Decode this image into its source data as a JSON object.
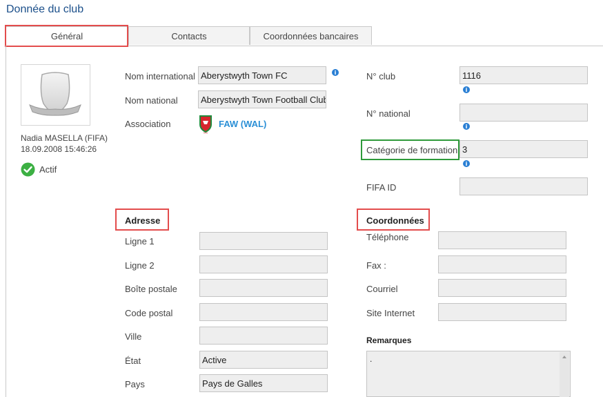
{
  "page": {
    "title": "Donnée du club"
  },
  "tabs": [
    {
      "label": "Général",
      "active": true
    },
    {
      "label": "Contacts",
      "active": false
    },
    {
      "label": "Coordonnées bancaires",
      "active": false
    }
  ],
  "club_card": {
    "logo_icon": "club-shield-placeholder-icon",
    "modified_by": "Nadia MASELLA (FIFA)",
    "modified_at": "18.09.2008 15:46:26",
    "status": "Actif",
    "status_icon": "check-circle-icon",
    "status_color": "#3cb043"
  },
  "identity": {
    "international_name_label": "Nom international",
    "international_name_value": "Aberystwyth Town FC",
    "national_name_label": "Nom national",
    "national_name_value": "Aberystwyth Town Football Club",
    "association_label": "Association",
    "association_value": "FAW (WAL)",
    "association_icon": "faw-crest-icon"
  },
  "club_ids": {
    "club_no_label": "N° club",
    "club_no_value": "1116",
    "national_no_label": "N° national",
    "national_no_value": "",
    "training_category_label": "Catégorie de formation",
    "training_category_value": "3",
    "fifa_id_label": "FIFA ID",
    "fifa_id_value": ""
  },
  "address": {
    "section_title": "Adresse",
    "line1_label": "Ligne 1",
    "line1_value": "",
    "line2_label": "Ligne 2",
    "line2_value": "",
    "po_box_label": "Boîte postale",
    "po_box_value": "",
    "postal_code_label": "Code postal",
    "postal_code_value": "",
    "city_label": "Ville",
    "city_value": "",
    "state_label": "État",
    "state_value": "Active",
    "country_label": "Pays",
    "country_value": "Pays de Galles"
  },
  "contact": {
    "section_title": "Coordonnées",
    "phone_label": "Téléphone",
    "phone_value": "",
    "fax_label": "Fax :",
    "fax_value": "",
    "email_label": "Courriel",
    "email_value": "",
    "website_label": "Site Internet",
    "website_value": "",
    "remarks_label": "Remarques",
    "remarks_value": "."
  },
  "info_icon": {
    "glyph": "i",
    "name": "info-icon",
    "color": "#2a7fd4"
  }
}
